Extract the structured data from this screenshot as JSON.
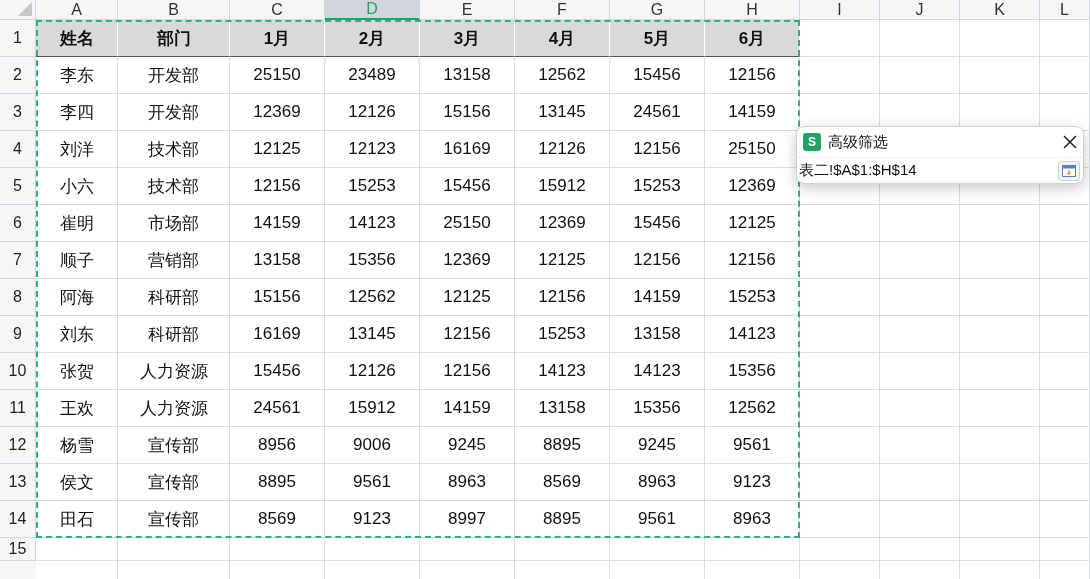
{
  "columns": [
    {
      "label": "A",
      "selected": false
    },
    {
      "label": "B",
      "selected": false
    },
    {
      "label": "C",
      "selected": false
    },
    {
      "label": "D",
      "selected": true
    },
    {
      "label": "E",
      "selected": false
    },
    {
      "label": "F",
      "selected": false
    },
    {
      "label": "G",
      "selected": false
    },
    {
      "label": "H",
      "selected": false
    },
    {
      "label": "I",
      "selected": false
    },
    {
      "label": "J",
      "selected": false
    },
    {
      "label": "K",
      "selected": false
    },
    {
      "label": "L",
      "selected": false
    }
  ],
  "rows": [
    {
      "number": "1",
      "kind": "header",
      "cells": [
        "姓名",
        "部门",
        "1月",
        "2月",
        "3月",
        "4月",
        "5月",
        "6月"
      ]
    },
    {
      "number": "2",
      "kind": "data",
      "cells": [
        "李东",
        "开发部",
        "25150",
        "23489",
        "13158",
        "12562",
        "15456",
        "12156"
      ]
    },
    {
      "number": "3",
      "kind": "data",
      "cells": [
        "李四",
        "开发部",
        "12369",
        "12126",
        "15156",
        "13145",
        "24561",
        "14159"
      ]
    },
    {
      "number": "4",
      "kind": "data",
      "cells": [
        "刘洋",
        "技术部",
        "12125",
        "12123",
        "16169",
        "12126",
        "12156",
        "25150"
      ]
    },
    {
      "number": "5",
      "kind": "data",
      "cells": [
        "小六",
        "技术部",
        "12156",
        "15253",
        "15456",
        "15912",
        "15253",
        "12369"
      ]
    },
    {
      "number": "6",
      "kind": "data",
      "cells": [
        "崔明",
        "市场部",
        "14159",
        "14123",
        "25150",
        "12369",
        "15456",
        "12125"
      ]
    },
    {
      "number": "7",
      "kind": "data",
      "cells": [
        "顺子",
        "营销部",
        "13158",
        "15356",
        "12369",
        "12125",
        "12156",
        "12156"
      ]
    },
    {
      "number": "8",
      "kind": "data",
      "cells": [
        "阿海",
        "科研部",
        "15156",
        "12562",
        "12125",
        "12156",
        "14159",
        "15253"
      ]
    },
    {
      "number": "9",
      "kind": "data",
      "cells": [
        "刘东",
        "科研部",
        "16169",
        "13145",
        "12156",
        "15253",
        "13158",
        "14123"
      ]
    },
    {
      "number": "10",
      "kind": "data",
      "cells": [
        "张贺",
        "人力资源",
        "15456",
        "12126",
        "12156",
        "14123",
        "14123",
        "15356"
      ]
    },
    {
      "number": "11",
      "kind": "data",
      "cells": [
        "王欢",
        "人力资源",
        "24561",
        "15912",
        "14159",
        "13158",
        "15356",
        "12562"
      ]
    },
    {
      "number": "12",
      "kind": "data",
      "cells": [
        "杨雪",
        "宣传部",
        "8956",
        "9006",
        "9245",
        "8895",
        "9245",
        "9561"
      ]
    },
    {
      "number": "13",
      "kind": "data",
      "cells": [
        "侯文",
        "宣传部",
        "8895",
        "9561",
        "8963",
        "8569",
        "8963",
        "9123"
      ]
    },
    {
      "number": "14",
      "kind": "data",
      "cells": [
        "田石",
        "宣传部",
        "8569",
        "9123",
        "8997",
        "8895",
        "9561",
        "8963"
      ]
    },
    {
      "number": "15",
      "kind": "empty",
      "cells": []
    }
  ],
  "dialog": {
    "app_badge": "S",
    "title": "高级筛选",
    "value": "表二!$A$1:$H$14"
  }
}
